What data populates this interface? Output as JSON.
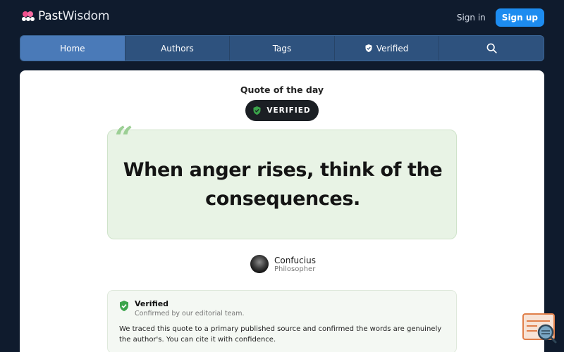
{
  "brand": {
    "name_part1": "Past",
    "name_part2": "Wisdom",
    "logo_icon": "flower-cluster-icon"
  },
  "auth": {
    "signin_label": "Sign in",
    "signup_label": "Sign up"
  },
  "nav": {
    "items": [
      {
        "label": "Home",
        "active": true
      },
      {
        "label": "Authors"
      },
      {
        "label": "Tags"
      },
      {
        "label": "Verified",
        "icon": "shield-check-icon"
      },
      {
        "label": "",
        "icon": "search-icon"
      }
    ]
  },
  "main": {
    "section_label": "Quote of the day",
    "badge_label": "VERIFIED",
    "quote": "When anger rises, think of the consequences.",
    "author": {
      "name": "Confucius",
      "role": "Philosopher"
    },
    "verification": {
      "title": "Verified",
      "subtitle": "Confirmed by our editorial team.",
      "body": "We traced this quote to a primary published source and confirmed the words are genuinely the author's. You can cite it with confidence."
    }
  },
  "colors": {
    "background": "#0f1b2d",
    "nav": "#2e527e",
    "nav_active": "#4a7ab8",
    "signup": "#1d8cf0",
    "quote_box": "#e8f3e5",
    "verified_green": "#3aa44a"
  }
}
